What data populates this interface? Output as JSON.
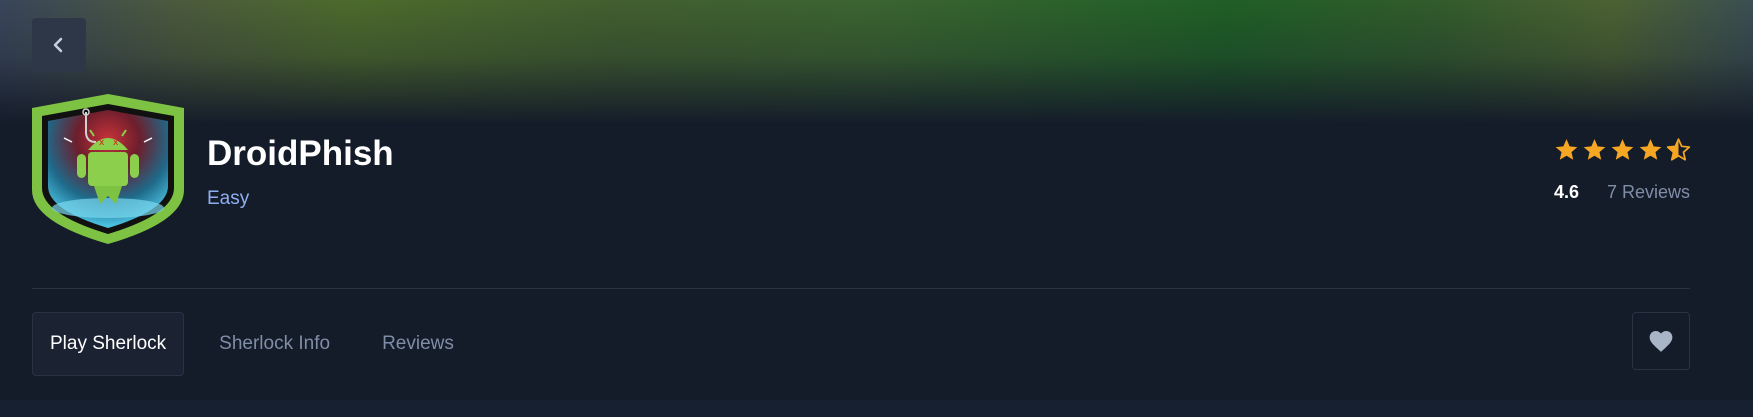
{
  "header": {
    "back_icon": "chevron-left-icon",
    "logo_icon": "android-phishing-shield-logo",
    "title": "DroidPhish",
    "difficulty": "Easy",
    "difficulty_color": "#8fb0f0"
  },
  "rating": {
    "stars": 4.5,
    "star_color": "#f5a623",
    "value": "4.6",
    "reviews_label": "7 Reviews"
  },
  "tabs": [
    {
      "label": "Play Sherlock",
      "active": true
    },
    {
      "label": "Sherlock Info",
      "active": false
    },
    {
      "label": "Reviews",
      "active": false
    }
  ],
  "actions": {
    "favorite_icon": "heart-icon"
  },
  "colors": {
    "background": "#141b29",
    "accent_green": "#7dc242"
  }
}
